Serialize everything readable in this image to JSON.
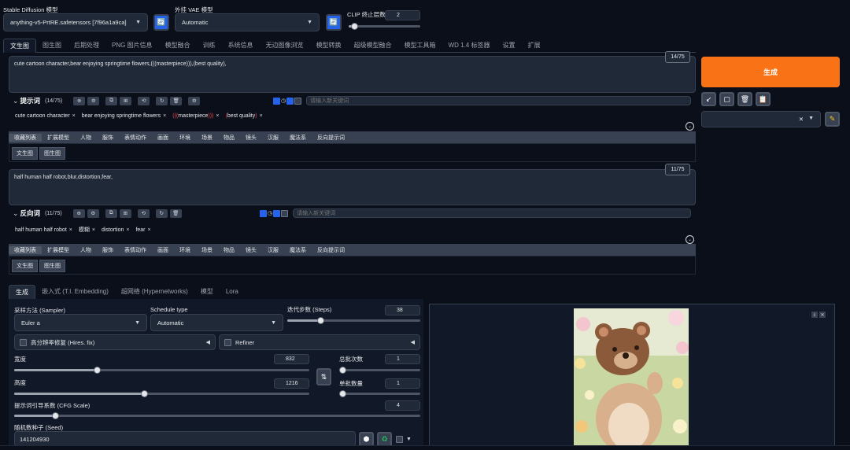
{
  "top": {
    "sd_model_label": "Stable Diffusion 模型",
    "sd_model_value": "anything-v5-PrtRE.safetensors [7f96a1a9ca]",
    "vae_label": "外挂 VAE 模型",
    "vae_value": "Automatic",
    "clip_label": "CLIP 终止层数",
    "clip_value": "2",
    "clip_level": 0.08
  },
  "tabs": [
    "文生图",
    "图生图",
    "后期处理",
    "PNG 图片信息",
    "模型融合",
    "训练",
    "系统信息",
    "无边图像浏览",
    "模型转换",
    "超级模型融合",
    "模型工具箱",
    "WD 1.4 标签器",
    "设置",
    "扩展"
  ],
  "positive": {
    "text": "cute cartoon character,bear enjoying springtime flowers,(((masterpiece))),(best quality),",
    "counter": "14/75",
    "title": "提示词",
    "count": "(14/75)",
    "keyword_placeholder": "请输入新关键词",
    "tags": [
      {
        "text": "cute cartoon character"
      },
      {
        "text": "bear enjoying springtime flowers"
      },
      {
        "pre": "(((",
        "text": "masterpiece",
        "post": ")))"
      },
      {
        "pre": "(",
        "text": "best quality",
        "post": ")"
      }
    ]
  },
  "negative": {
    "text": "half human half robot,blur,distortion,fear,",
    "counter": "11/75",
    "title": "反向词",
    "count": "(11/75)",
    "keyword_placeholder": "请输入新关键词",
    "tags": [
      {
        "text": "half human half robot"
      },
      {
        "text": "模糊"
      },
      {
        "text": "distortion"
      },
      {
        "text": "fear"
      }
    ]
  },
  "categories": [
    "收藏列表",
    "扩展模型",
    "人物",
    "服饰",
    "表情动作",
    "画面",
    "环境",
    "场景",
    "物品",
    "镜头",
    "汉服",
    "魔法系",
    "反向提示词"
  ],
  "subtabs": [
    "文生图",
    "图生图"
  ],
  "generate": {
    "button": "生成",
    "style_value": "",
    "tool_icons": [
      "arrow-icon",
      "square-icon",
      "trash-icon",
      "clipboard-icon"
    ]
  },
  "gen_tabs": [
    "生成",
    "嵌入式 (T.I. Embedding)",
    "超网络 (Hypernetworks)",
    "模型",
    "Lora"
  ],
  "params": {
    "sampler_label": "采样方法 (Sampler)",
    "sampler_value": "Euler a",
    "schedule_label": "Schedule type",
    "schedule_value": "Automatic",
    "steps_label": "迭代步数 (Steps)",
    "steps_value": "38",
    "steps_level": 0.25,
    "hires_label": "高分辨率修复 (Hires. fix)",
    "refiner_label": "Refiner",
    "width_label": "宽度",
    "width_value": "832",
    "width_level": 0.28,
    "height_label": "高度",
    "height_value": "1216",
    "height_level": 0.44,
    "batch_count_label": "总批次数",
    "batch_count_value": "1",
    "batch_count_level": 0.0,
    "batch_size_label": "单批数量",
    "batch_size_value": "1",
    "batch_size_level": 0.0,
    "cfg_label": "提示词引导系数 (CFG Scale)",
    "cfg_value": "4",
    "cfg_level": 0.1,
    "seed_label": "随机数种子 (Seed)",
    "seed_value": "141204930"
  },
  "colors": {
    "accent": "#f97316",
    "primary": "#2563eb",
    "background": "#0b0f19"
  }
}
